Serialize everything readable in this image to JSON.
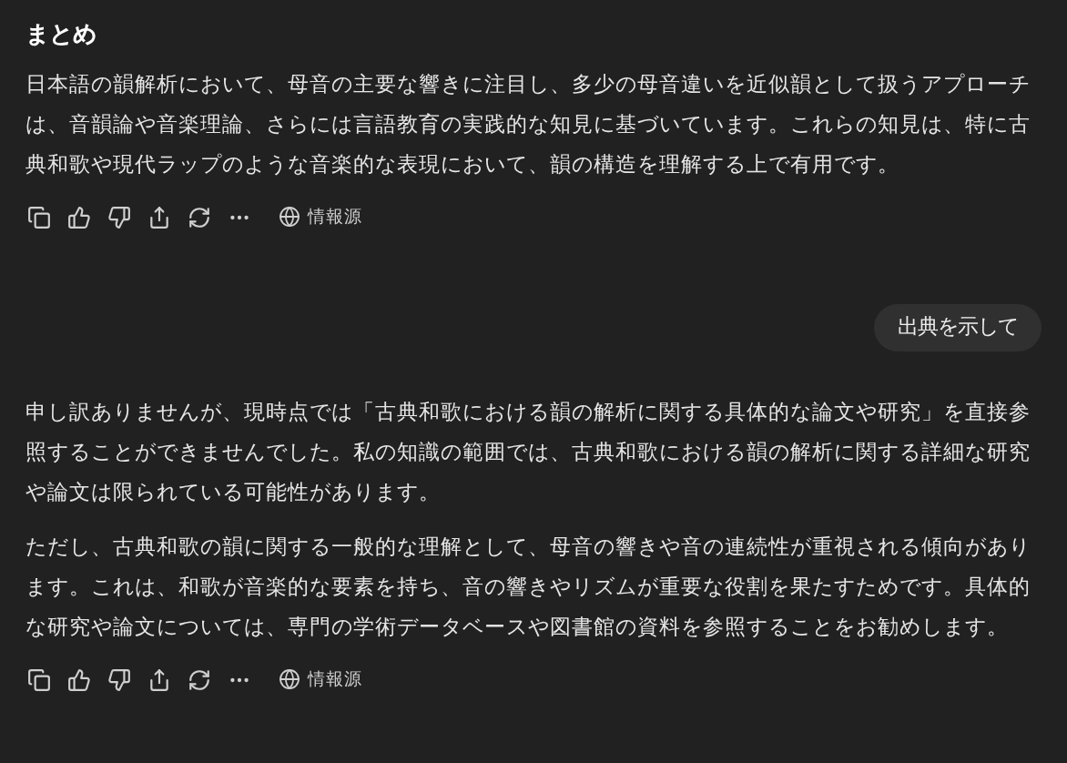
{
  "messages": [
    {
      "kind": "assistant",
      "heading": "まとめ",
      "paragraphs": [
        "日本語の韻解析において、母音の主要な響きに注目し、多少の母音違いを近似韻として扱うアプローチは、音韻論や音楽理論、さらには言語教育の実践的な知見に基づいています。これらの知見は、特に古典和歌や現代ラップのような音楽的な表現において、韻の構造を理解する上で有用です。"
      ],
      "actions": {
        "sources_label": "情報源"
      }
    },
    {
      "kind": "user",
      "text": "出典を示して"
    },
    {
      "kind": "assistant",
      "paragraphs": [
        "申し訳ありませんが、現時点では「古典和歌における韻の解析に関する具体的な論文や研究」を直接参照することができませんでした。私の知識の範囲では、古典和歌における韻の解析に関する詳細な研究や論文は限られている可能性があります。",
        "ただし、古典和歌の韻に関する一般的な理解として、母音の響きや音の連続性が重視される傾向があります。これは、和歌が音楽的な要素を持ち、音の響きやリズムが重要な役割を果たすためです。具体的な研究や論文については、専門の学術データベースや図書館の資料を参照することをお勧めします。"
      ],
      "actions": {
        "sources_label": "情報源"
      }
    }
  ]
}
